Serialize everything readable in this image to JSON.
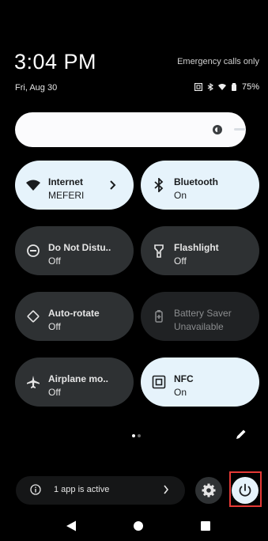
{
  "status": {
    "time": "3:04 PM",
    "date": "Fri, Aug 30",
    "emergency": "Emergency calls only",
    "battery": "75%"
  },
  "tiles": [
    {
      "label": "Internet",
      "sub": "MEFERI",
      "state": "on",
      "icon": "wifi-icon"
    },
    {
      "label": "Bluetooth",
      "sub": "On",
      "state": "on",
      "icon": "bluetooth-icon"
    },
    {
      "label": "Do Not Distu..",
      "sub": "Off",
      "state": "off",
      "icon": "dnd-icon"
    },
    {
      "label": "Flashlight",
      "sub": "Off",
      "state": "off",
      "icon": "flashlight-icon"
    },
    {
      "label": "Auto-rotate",
      "sub": "Off",
      "state": "off",
      "icon": "rotate-icon"
    },
    {
      "label": "Battery Saver",
      "sub": "Unavailable",
      "state": "unavailable",
      "icon": "battery-saver-icon"
    },
    {
      "label": "Airplane mo..",
      "sub": "Off",
      "state": "off",
      "icon": "airplane-icon"
    },
    {
      "label": "NFC",
      "sub": "On",
      "state": "on",
      "icon": "nfc-icon"
    }
  ],
  "footer": {
    "active_apps": "1 app is active"
  },
  "colors": {
    "tile_on": "#e6f3fb",
    "tile_off": "#2e3133",
    "highlight": "#e53935"
  }
}
